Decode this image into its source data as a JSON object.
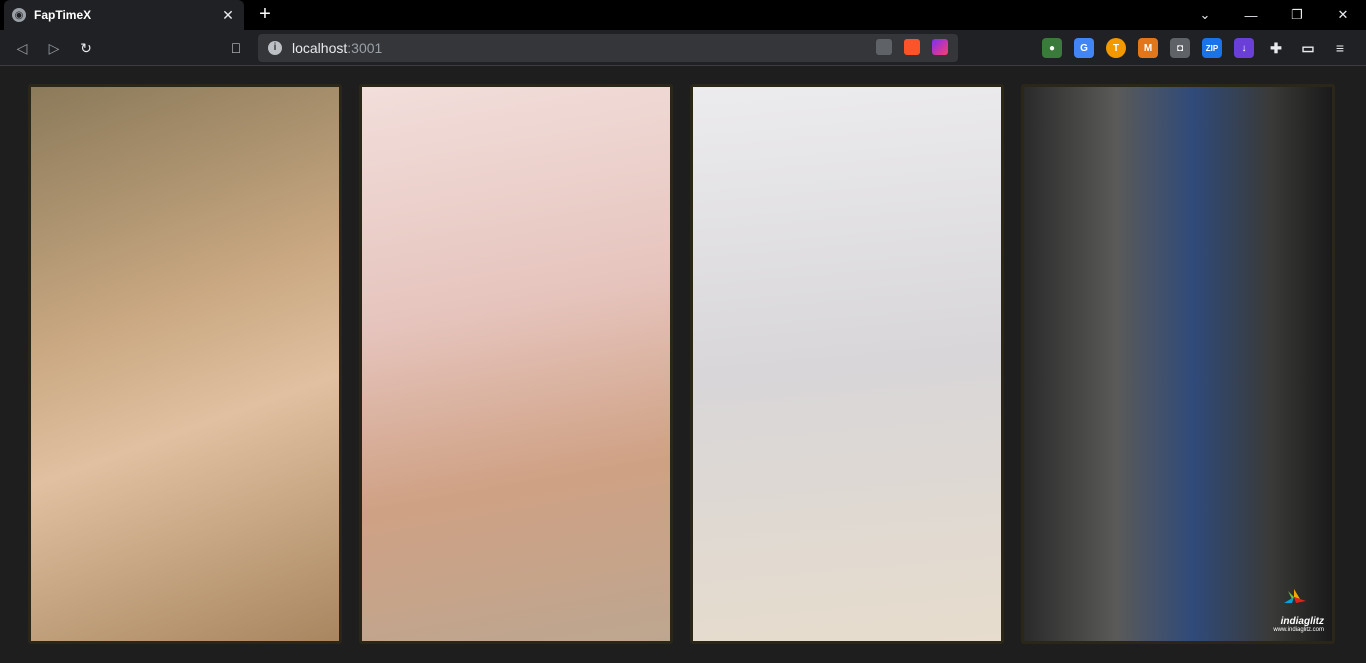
{
  "browser": {
    "tab_title": "FapTimeX",
    "tab_close": "✕",
    "new_tab": "+",
    "url_host": "localhost",
    "url_port": ":3001",
    "window_controls": {
      "dropdown": "⌄",
      "minimize": "—",
      "restore": "❐",
      "close": "✕"
    },
    "nav": {
      "back": "◁",
      "forward": "▷",
      "reload": "↻",
      "bookmark": "⎕"
    },
    "extensions": [
      "extension-globe",
      "google-translate",
      "extension-t",
      "metamask",
      "screenshot",
      "zip",
      "download",
      "puzzle",
      "wallet",
      "menu"
    ]
  },
  "gallery": {
    "cards": [
      {
        "alt": "photo-1",
        "bg": "#b89a7a"
      },
      {
        "alt": "photo-2",
        "bg": "#e8c8c2"
      },
      {
        "alt": "photo-3",
        "bg": "#e6e2e4"
      },
      {
        "alt": "photo-4",
        "bg": "#4a4a48",
        "caption": "indiaglitz",
        "caption_url": "www.indiaglitz.com"
      }
    ]
  }
}
